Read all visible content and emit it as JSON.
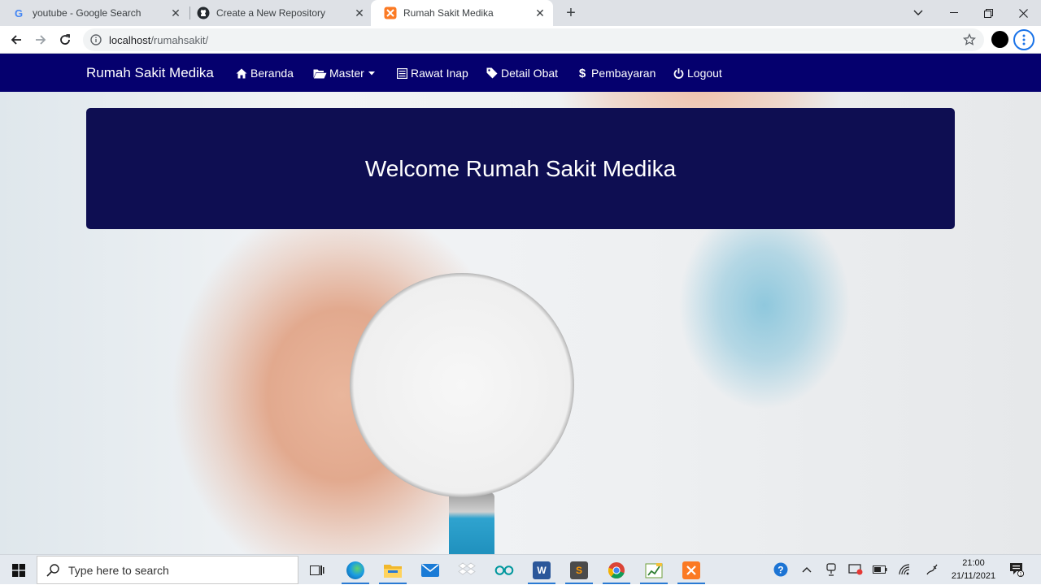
{
  "browser": {
    "tabs": [
      {
        "title": "youtube - Google Search",
        "icon": "google-icon"
      },
      {
        "title": "Create a New Repository",
        "icon": "github-icon"
      },
      {
        "title": "Rumah Sakit Medika",
        "icon": "xampp-icon",
        "active": true
      }
    ],
    "url_host": "localhost",
    "url_path": "/rumahsakit/"
  },
  "navbar": {
    "brand": "Rumah Sakit Medika",
    "items": [
      {
        "label": "Beranda",
        "icon": "home-icon"
      },
      {
        "label": "Master",
        "icon": "folder-open-icon",
        "dropdown": true
      },
      {
        "label": "Rawat Inap",
        "icon": "list-alt-icon"
      },
      {
        "label": "Detail Obat",
        "icon": "tag-icon"
      },
      {
        "label": "Pembayaran",
        "icon": "dollar-icon"
      },
      {
        "label": "Logout",
        "icon": "power-icon"
      }
    ],
    "color": "#05006e"
  },
  "jumbotron": {
    "heading": "Welcome Rumah Sakit Medika",
    "color": "#0e0e52"
  },
  "taskbar": {
    "search_placeholder": "Type here to search",
    "apps": [
      "task-view-icon",
      "edge-icon",
      "file-explorer-icon",
      "mail-icon",
      "dropbox-icon",
      "arduino-icon",
      "word-icon",
      "sublime-text-icon",
      "chrome-icon",
      "excel-icon",
      "xampp-icon"
    ],
    "time": "21:00",
    "date": "21/11/2021"
  }
}
